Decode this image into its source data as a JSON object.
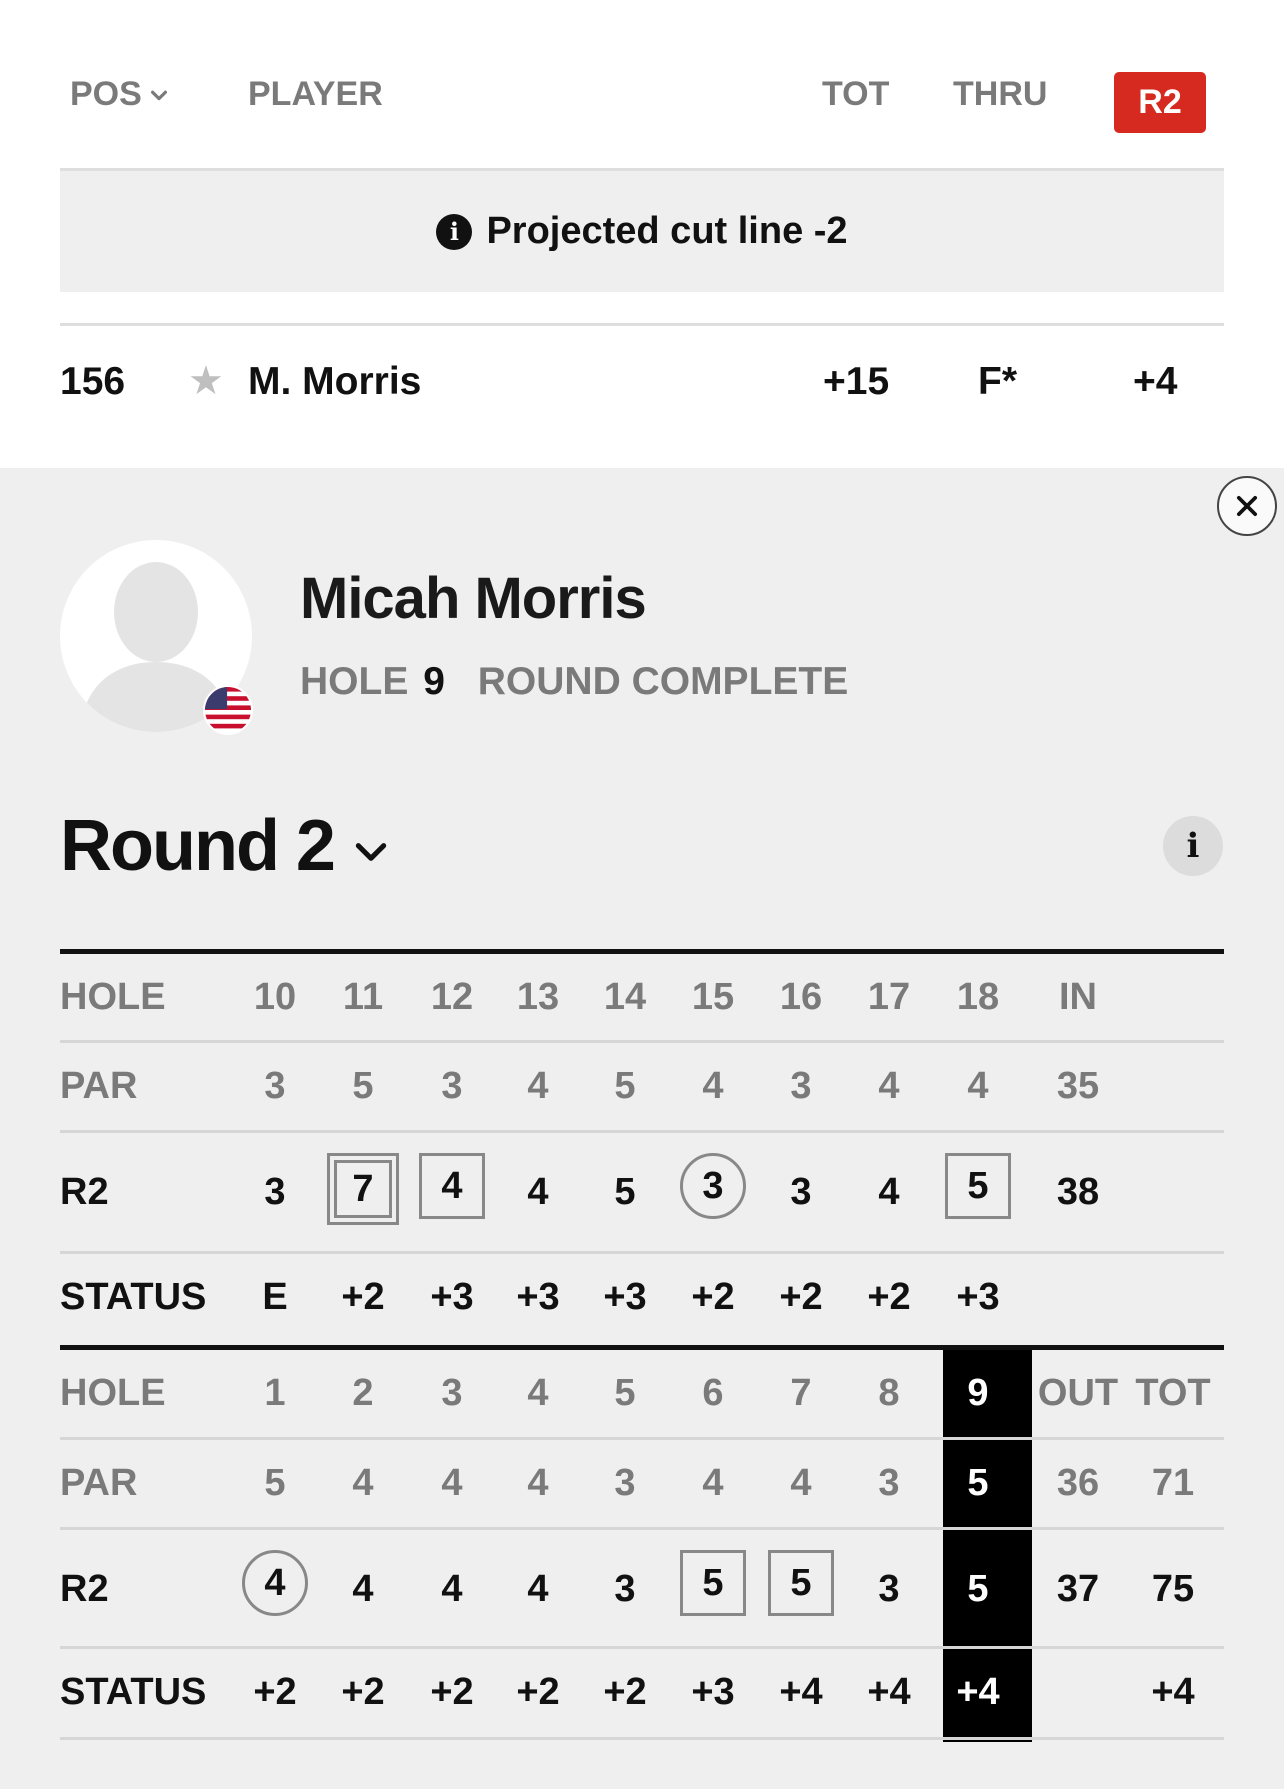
{
  "leaderboard_header": {
    "pos": "POS",
    "player": "PLAYER",
    "tot": "TOT",
    "thru": "THRU",
    "round_badge": "R2"
  },
  "cut_line": {
    "text": "Projected cut line -2"
  },
  "player_row": {
    "pos": "156",
    "name": "M. Morris",
    "tot": "+15",
    "thru": "F*",
    "round_score": "+4"
  },
  "player_card": {
    "full_name": "Micah Morris",
    "hole_label": "HOLE",
    "hole_number": "9",
    "round_status": "ROUND COMPLETE",
    "round_title": "Round 2"
  },
  "back_nine": {
    "hole_label": "HOLE",
    "par_label": "PAR",
    "score_label": "R2",
    "status_label": "STATUS",
    "holes": [
      "10",
      "11",
      "12",
      "13",
      "14",
      "15",
      "16",
      "17",
      "18",
      "IN"
    ],
    "par": [
      "3",
      "5",
      "3",
      "4",
      "5",
      "4",
      "3",
      "4",
      "4",
      "35"
    ],
    "scores": [
      "3",
      "7",
      "4",
      "4",
      "5",
      "3",
      "3",
      "4",
      "5",
      "38"
    ],
    "score_marks": [
      "",
      "double-bogey",
      "bogey",
      "",
      "",
      "birdie",
      "",
      "",
      "bogey",
      ""
    ],
    "status": [
      "E",
      "+2",
      "+3",
      "+3",
      "+3",
      "+2",
      "+2",
      "+2",
      "+3",
      ""
    ]
  },
  "front_nine": {
    "hole_label": "HOLE",
    "par_label": "PAR",
    "score_label": "R2",
    "status_label": "STATUS",
    "holes": [
      "1",
      "2",
      "3",
      "4",
      "5",
      "6",
      "7",
      "8",
      "9",
      "OUT",
      "TOT"
    ],
    "par": [
      "5",
      "4",
      "4",
      "4",
      "3",
      "4",
      "4",
      "3",
      "5",
      "36",
      "71"
    ],
    "scores": [
      "4",
      "4",
      "4",
      "4",
      "3",
      "5",
      "5",
      "3",
      "5",
      "37",
      "75"
    ],
    "score_marks": [
      "birdie",
      "",
      "",
      "",
      "",
      "bogey",
      "bogey",
      "",
      "",
      "",
      ""
    ],
    "status": [
      "+2",
      "+2",
      "+2",
      "+2",
      "+2",
      "+3",
      "+4",
      "+4",
      "+4",
      "",
      "+4"
    ],
    "current_hole_index": 8
  },
  "colors": {
    "accent_red": "#d6291f",
    "current_hole_bg": "#000000"
  },
  "icons": {
    "sort": "chevron-down-icon",
    "info": "info-icon",
    "favorite": "star-icon",
    "close": "close-icon",
    "flag": "us-flag-icon"
  }
}
